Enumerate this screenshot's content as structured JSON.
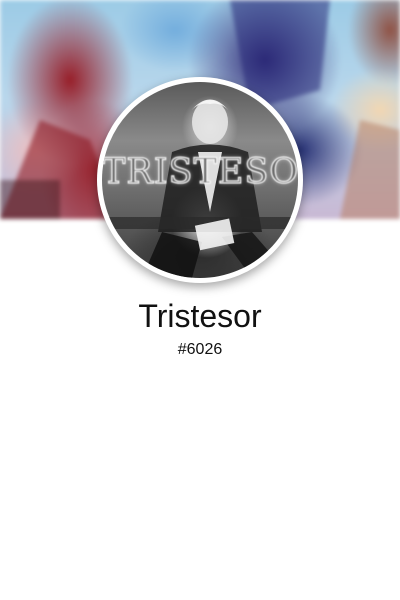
{
  "profile": {
    "display_name": "Tristesor",
    "discriminator": "#6026",
    "avatar_text": "TRISTESOR"
  },
  "colors": {
    "background": "#ffffff",
    "text": "#111111",
    "avatar_ring": "#ffffff"
  },
  "icons": {
    "avatar": "user-avatar-image",
    "banner": "profile-banner-image"
  }
}
